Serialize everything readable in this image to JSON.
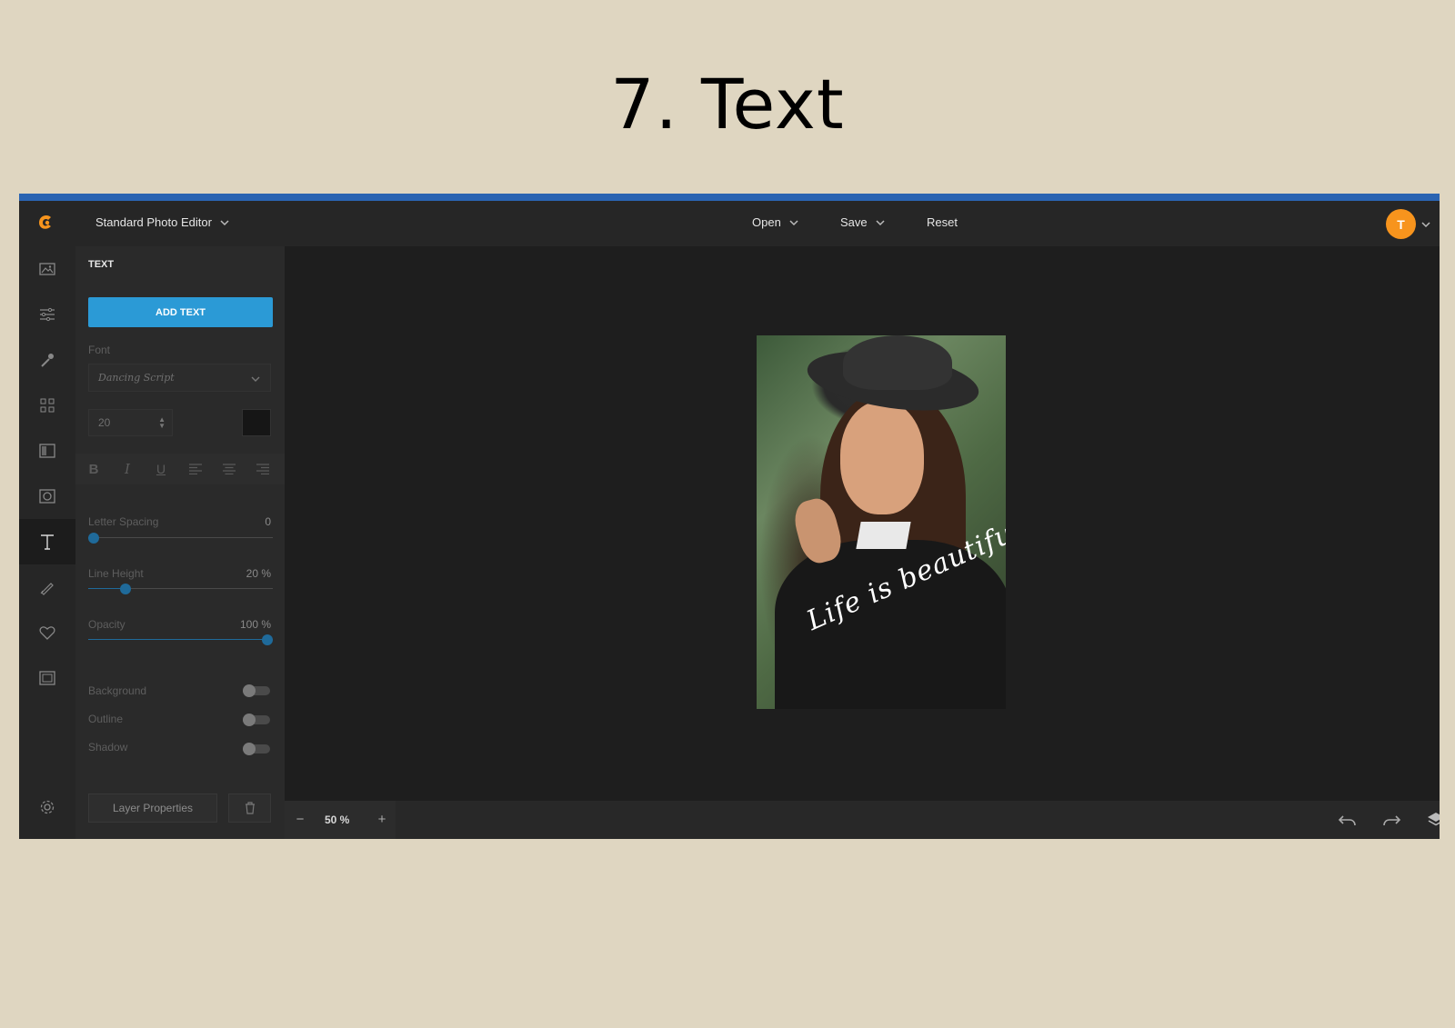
{
  "slide_title": "7. Text",
  "topbar": {
    "editor_name": "Standard Photo Editor",
    "open_label": "Open",
    "save_label": "Save",
    "reset_label": "Reset",
    "avatar_initial": "T"
  },
  "toolrail": {
    "items": [
      "image-icon",
      "adjust-icon",
      "retouch-icon",
      "grid-icon",
      "filter-icon",
      "frame-icon",
      "text-icon",
      "draw-icon",
      "heart-icon",
      "border-icon",
      "gear-icon"
    ],
    "active": "text-icon"
  },
  "panel": {
    "title": "TEXT",
    "add_text_label": "ADD TEXT",
    "font_label": "Font",
    "font_value": "Dancing Script",
    "size_value": "20",
    "color_value": "#161616",
    "letter_spacing": {
      "label": "Letter Spacing",
      "value": "0",
      "fraction": 0.0
    },
    "line_height": {
      "label": "Line Height",
      "value": "20 %",
      "fraction": 0.2
    },
    "opacity": {
      "label": "Opacity",
      "value": "100 %",
      "fraction": 1.0
    },
    "background_label": "Background",
    "outline_label": "Outline",
    "shadow_label": "Shadow",
    "layer_properties_label": "Layer Properties"
  },
  "canvas": {
    "overlay_text": "Life is beautiful."
  },
  "bottombar": {
    "zoom_minus": "−",
    "zoom_value": "50 %",
    "zoom_plus": "+"
  },
  "colors": {
    "accent": "#2b9ad6",
    "top_stripe": "#2a64b2",
    "avatar": "#f7941d",
    "logo": "#f7941d",
    "slider": "#1f6a9a"
  }
}
